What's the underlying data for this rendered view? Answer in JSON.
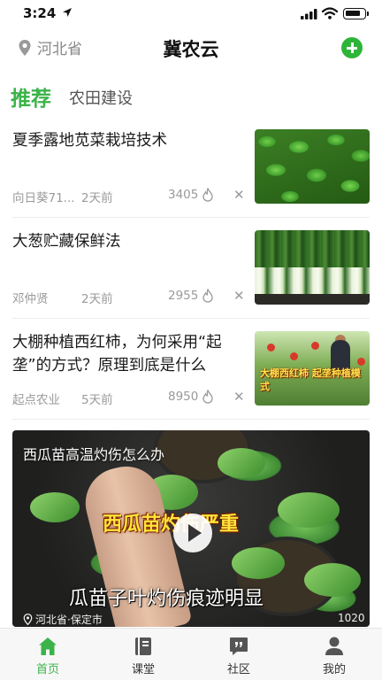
{
  "status_bar": {
    "time": "3:24"
  },
  "header": {
    "region": "河北省",
    "title": "冀农云"
  },
  "tabs": [
    {
      "label": "推荐",
      "active": true
    },
    {
      "label": "农田建设",
      "active": false
    }
  ],
  "feed": [
    {
      "title": "夏季露地苋菜栽培技术",
      "author": "向日葵71...",
      "time": "2天前",
      "views": "3405"
    },
    {
      "title": "大葱贮藏保鲜法",
      "author": "邓仲贤",
      "time": "2天前",
      "views": "2955"
    },
    {
      "title": "大棚种植西红柿，为何采用“起垄”的方式？原理到底是什么",
      "author": "起点农业",
      "time": "5天前",
      "views": "8950",
      "thumb_caption": "大棚西红柿 起垄种植模式"
    }
  ],
  "video": {
    "title": "西瓜苗高温灼伤怎么办",
    "caption_top": "西瓜苗灼伤严重",
    "caption_bottom": "瓜苗子叶灼伤痕迹明显",
    "location": "河北省·保定市",
    "count": "1020"
  },
  "bottom_nav": [
    {
      "label": "首页",
      "icon": "home-icon",
      "active": true
    },
    {
      "label": "课堂",
      "icon": "book-icon",
      "active": false
    },
    {
      "label": "社区",
      "icon": "chat-quote-icon",
      "active": false
    },
    {
      "label": "我的",
      "icon": "user-icon",
      "active": false
    }
  ],
  "colors": {
    "accent": "#3bb34a",
    "add_button": "#2fb43a",
    "meta_text": "#9a9a9a"
  }
}
